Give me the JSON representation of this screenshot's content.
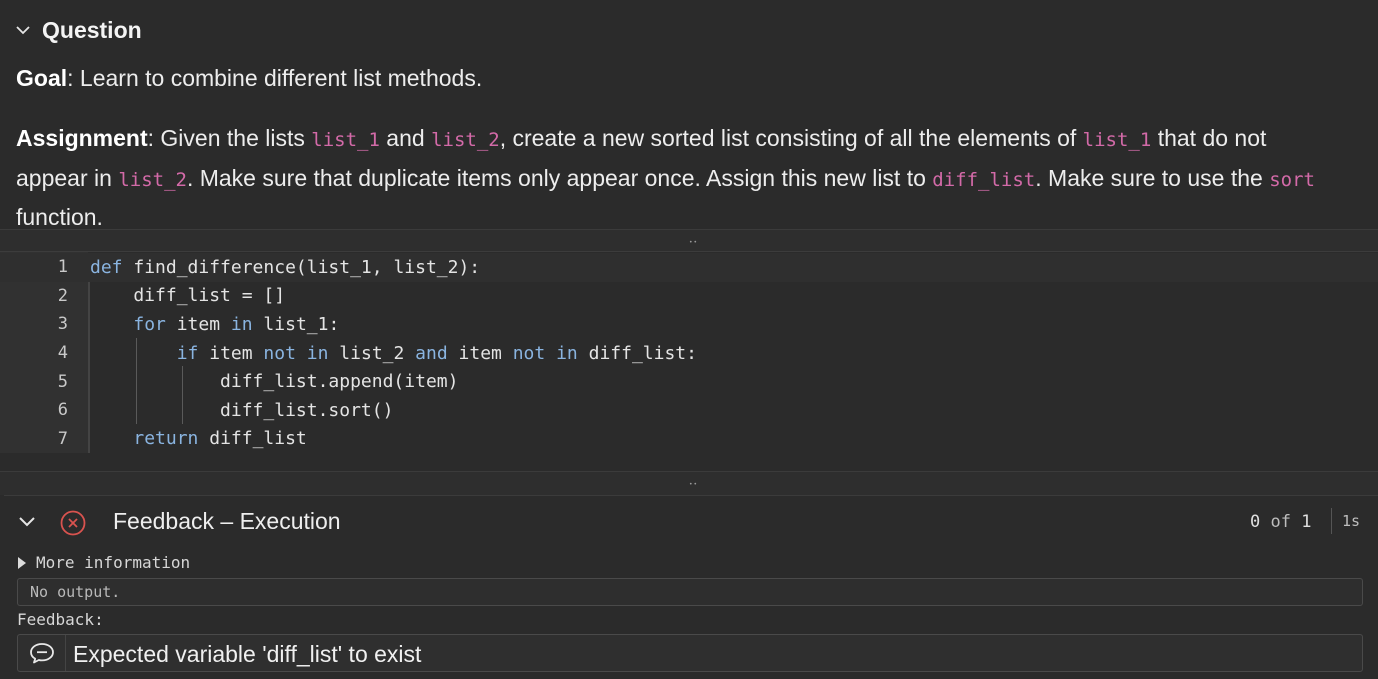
{
  "question": {
    "title": "Question",
    "goal_label": "Goal",
    "goal_text": ": Learn to combine different list methods.",
    "assignment_label": "Assignment",
    "assignment_parts": [
      ": Given the lists ",
      "list_1",
      " and ",
      "list_2",
      ", create a new sorted list consisting of all the elements of ",
      "list_1",
      " that do not appear in ",
      "list_2",
      ". Make sure that duplicate items only appear once. Assign this new list to ",
      "diff_list",
      ". Make sure to use the ",
      "sort",
      " function."
    ]
  },
  "splitter_dots": "••",
  "editor": {
    "lines": [
      {
        "n": "1",
        "tokens": [
          [
            "kw",
            "def"
          ],
          [
            "t",
            " find_difference(list_1, list_2):"
          ]
        ]
      },
      {
        "n": "2",
        "tokens": [
          [
            "t",
            "    diff_list = []"
          ]
        ]
      },
      {
        "n": "3",
        "tokens": [
          [
            "t",
            "    "
          ],
          [
            "kw",
            "for"
          ],
          [
            "t",
            " item "
          ],
          [
            "kw",
            "in"
          ],
          [
            "t",
            " list_1:"
          ]
        ]
      },
      {
        "n": "4",
        "tokens": [
          [
            "t",
            "        "
          ],
          [
            "kw",
            "if"
          ],
          [
            "t",
            " item "
          ],
          [
            "kw",
            "not"
          ],
          [
            "t",
            " "
          ],
          [
            "kw",
            "in"
          ],
          [
            "t",
            " list_2 "
          ],
          [
            "kw",
            "and"
          ],
          [
            "t",
            " item "
          ],
          [
            "kw",
            "not"
          ],
          [
            "t",
            " "
          ],
          [
            "kw",
            "in"
          ],
          [
            "t",
            " diff_list:"
          ]
        ]
      },
      {
        "n": "5",
        "tokens": [
          [
            "t",
            "            diff_list.append(item)"
          ]
        ]
      },
      {
        "n": "6",
        "tokens": [
          [
            "t",
            "            diff_list.sort()"
          ]
        ]
      },
      {
        "n": "7",
        "tokens": [
          [
            "t",
            "    "
          ],
          [
            "kw",
            "return"
          ],
          [
            "t",
            " diff_list"
          ]
        ]
      }
    ]
  },
  "feedback": {
    "title": "Feedback – Execution",
    "passed": "0",
    "of": "of",
    "total": "1",
    "time": "1s",
    "more_info": "More information",
    "output": "No output.",
    "feedback_label": "Feedback:",
    "message": "Expected variable 'diff_list' to exist"
  },
  "colors": {
    "inline_code": "#d36aa8",
    "keyword": "#8ab4e0",
    "error": "#d9534f"
  }
}
